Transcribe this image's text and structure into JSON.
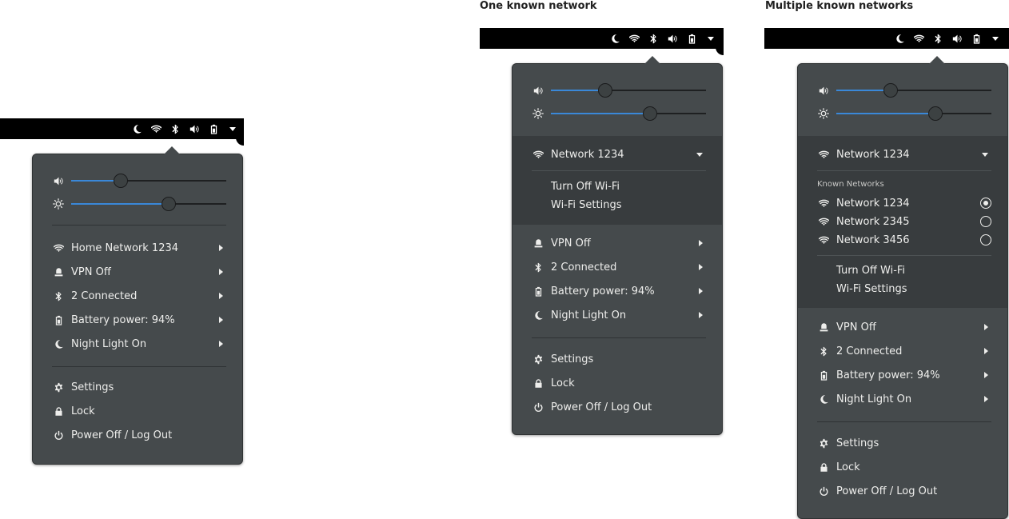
{
  "headings": {
    "one_known": "One known network",
    "multiple_known": "Multiple known networks"
  },
  "panel1": {
    "network_label": "Home Network 1234",
    "vpn_label": "VPN Off",
    "bluetooth_label": "2 Connected",
    "battery_label": "Battery power: 94%",
    "night_light_label": "Night Light On",
    "settings_label": "Settings",
    "lock_label": "Lock",
    "power_label": "Power Off / Log Out",
    "volume_level": 0.32,
    "brightness_level": 0.63
  },
  "panel2": {
    "network_label": "Network 1234",
    "turn_off_wifi": "Turn Off Wi-Fi",
    "wifi_settings": "Wi-Fi Settings",
    "vpn_label": "VPN Off",
    "bluetooth_label": "2 Connected",
    "battery_label": "Battery power: 94%",
    "night_light_label": "Night Light On",
    "settings_label": "Settings",
    "lock_label": "Lock",
    "power_label": "Power Off / Log Out",
    "volume_level": 0.35,
    "brightness_level": 0.64
  },
  "panel3": {
    "network_label": "Network 1234",
    "known_networks_heading": "Known Networks",
    "known_networks": [
      "Network 1234",
      "Network 2345",
      "Network 3456"
    ],
    "selected_network": "Network 1234",
    "turn_off_wifi": "Turn Off Wi-Fi",
    "wifi_settings": "Wi-Fi Settings",
    "vpn_label": "VPN Off",
    "bluetooth_label": "2 Connected",
    "battery_label": "Battery power: 94%",
    "night_light_label": "Night Light On",
    "settings_label": "Settings",
    "lock_label": "Lock",
    "power_label": "Power Off / Log Out",
    "volume_level": 0.35,
    "brightness_level": 0.64
  },
  "colors": {
    "panel_bg": "#454a4c",
    "submenu_bg": "#383c3e",
    "slider_fill": "#3a88d8",
    "topbar": "#000000",
    "text": "#eeeeec"
  },
  "tray_icons": [
    "night-light-icon",
    "wifi-icon",
    "bluetooth-icon",
    "volume-icon",
    "battery-icon",
    "dropdown-arrow-icon"
  ]
}
